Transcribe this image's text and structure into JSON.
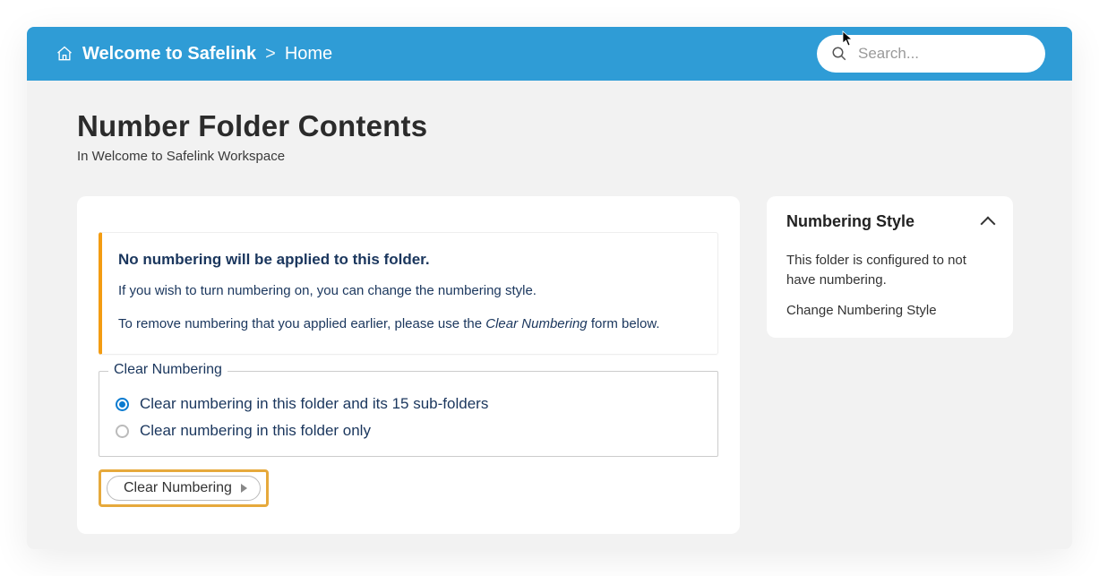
{
  "header": {
    "title": "Welcome to Safelink",
    "separator": ">",
    "crumb": "Home",
    "search_placeholder": "Search..."
  },
  "page": {
    "title": "Number Folder Contents",
    "subtitle": "In Welcome to Safelink Workspace"
  },
  "callout": {
    "heading": "No numbering will be applied to this folder.",
    "line1_a": "If you wish to turn numbering on, you can ",
    "line1_link": "change the numbering style.",
    "line2_a": "To remove numbering that you applied earlier, please use the ",
    "line2_em": "Clear Numbering",
    "line2_b": " form below."
  },
  "fieldset": {
    "legend": "Clear Numbering",
    "option1": "Clear numbering in this folder and its 15 sub-folders",
    "option2": "Clear numbering in this folder only",
    "selected": 0
  },
  "actions": {
    "clear_button": "Clear Numbering"
  },
  "sidebar": {
    "title": "Numbering Style",
    "body": "This folder is configured to not have numbering.",
    "link": "Change Numbering Style"
  }
}
